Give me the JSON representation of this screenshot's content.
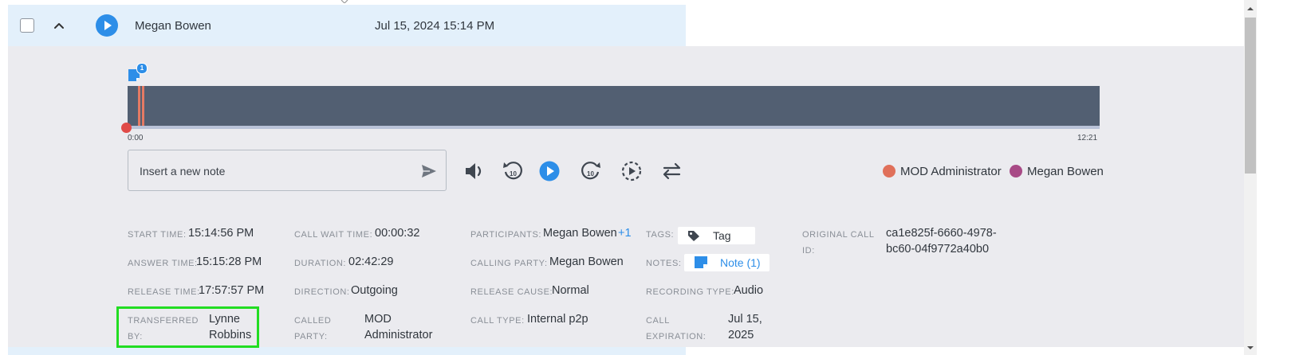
{
  "call": {
    "name": "Megan Bowen",
    "date": "Jul 15, 2024 15:14 PM"
  },
  "player": {
    "note_count": "1",
    "time_start": "0:00",
    "time_end": "12:21",
    "note_placeholder": "Insert a new note",
    "legend": [
      {
        "label": "MOD Administrator",
        "color": "#e0705a"
      },
      {
        "label": "Megan Bowen",
        "color": "#a84a86"
      }
    ]
  },
  "details": {
    "start_time_label": "Start time:",
    "start_time": "15:14:56 PM",
    "answer_time_label": "Answer time:",
    "answer_time": "15:15:28 PM",
    "release_time_label": "Release time:",
    "release_time": "17:57:57 PM",
    "transferred_by_label_1": "Transferred",
    "transferred_by_label_2": "by:",
    "transferred_by_1": "Lynne",
    "transferred_by_2": "Robbins",
    "call_wait_label": "Call wait time:",
    "call_wait": "00:00:32",
    "duration_label": "Duration:",
    "duration": "02:42:29",
    "direction_label": "Direction:",
    "direction": "Outgoing",
    "called_party_label_1": "Called",
    "called_party_label_2": "party:",
    "called_party_1": "MOD",
    "called_party_2": "Administrator",
    "participants_label": "Participants:",
    "participants": "Megan Bowen",
    "participants_extra": "+1",
    "calling_party_label": "Calling party:",
    "calling_party": "Megan Bowen",
    "release_cause_label": "Release cause:",
    "release_cause": "Normal",
    "call_type_label": "Call type:",
    "call_type": "Internal p2p",
    "tags_label": "Tags:",
    "tag": "Tag",
    "notes_label": "Notes:",
    "notes": "Note (1)",
    "recording_type_label": "Recording type:",
    "recording_type": "Audio",
    "call_expiration_label_1": "Call",
    "call_expiration_label_2": "expiration:",
    "call_expiration_1": "Jul 15,",
    "call_expiration_2": "2025",
    "original_call_id_label_1": "Original call",
    "original_call_id_label_2": "ID:",
    "original_call_id_1": "ca1e825f-6660-4978-",
    "original_call_id_2": "bc60-04f9772a40b0"
  }
}
